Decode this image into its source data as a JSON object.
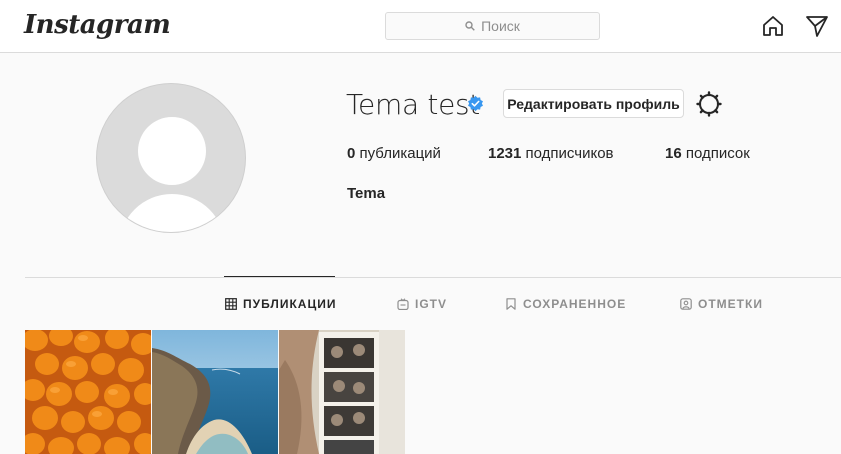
{
  "brand": {
    "logo_text": "Instagram"
  },
  "search": {
    "placeholder": "Поиск"
  },
  "icons": {
    "home": "home-icon",
    "direct": "paper-plane-icon",
    "search": "search-icon",
    "settings": "gear-icon",
    "verified": "verified-badge-icon"
  },
  "profile": {
    "username": "Tema test",
    "edit_button": "Редактировать профиль",
    "full_name": "Tema",
    "stats": {
      "posts_count": "0",
      "posts_label": "публикаций",
      "followers_count": "1231",
      "followers_label": "подписчиков",
      "following_count": "16",
      "following_label": "подписок"
    }
  },
  "tabs": [
    {
      "label": "ПУБЛИКАЦИИ",
      "active": true,
      "icon": "grid-icon"
    },
    {
      "label": "IGTV",
      "active": false,
      "icon": "igtv-icon"
    },
    {
      "label": "СОХРАНЕННОЕ",
      "active": false,
      "icon": "bookmark-icon"
    },
    {
      "label": "ОТМЕТКИ",
      "active": false,
      "icon": "tagged-icon"
    }
  ],
  "colors": {
    "accent_verified": "#3897f0",
    "text": "#262626",
    "muted": "#8e8e8e",
    "border": "#dbdbdb",
    "background": "#fafafa"
  }
}
